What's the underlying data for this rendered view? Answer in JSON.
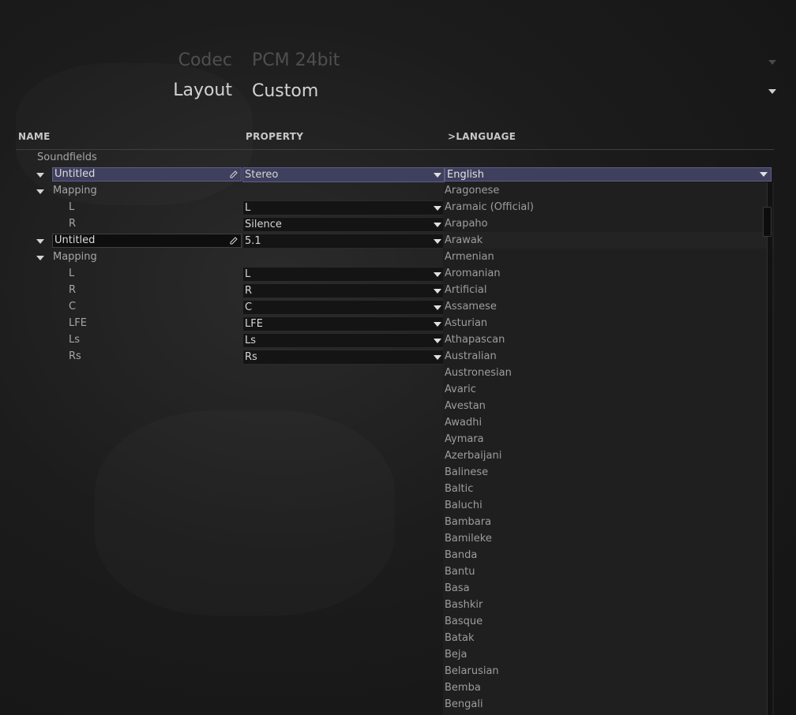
{
  "codec": {
    "label": "Codec",
    "value": "PCM 24bit"
  },
  "layout": {
    "label": "Layout",
    "value": "Custom"
  },
  "columns": {
    "name": "NAME",
    "property": "PROPERTY",
    "language": ">LANGUAGE"
  },
  "tree": {
    "root_label": "Soundfields",
    "soundfield1": {
      "name": "Untitled",
      "property": "Stereo",
      "mapping_label": "Mapping",
      "channels": [
        {
          "name": "L",
          "value": "L"
        },
        {
          "name": "R",
          "value": "Silence"
        }
      ]
    },
    "soundfield2": {
      "name": "Untitled",
      "property": "5.1",
      "mapping_label": "Mapping",
      "channels": [
        {
          "name": "L",
          "value": "L"
        },
        {
          "name": "R",
          "value": "R"
        },
        {
          "name": "C",
          "value": "C"
        },
        {
          "name": "LFE",
          "value": "LFE"
        },
        {
          "name": "Ls",
          "value": "Ls"
        },
        {
          "name": "Rs",
          "value": "Rs"
        }
      ]
    }
  },
  "language": {
    "selected": "English",
    "hovered": "Arawak",
    "options": [
      "Aragonese",
      "Aramaic (Official)",
      "Arapaho",
      "Arawak",
      "Armenian",
      "Aromanian",
      "Artificial",
      "Assamese",
      "Asturian",
      "Athapascan",
      "Australian",
      "Austronesian",
      "Avaric",
      "Avestan",
      "Awadhi",
      "Aymara",
      "Azerbaijani",
      "Balinese",
      "Baltic",
      "Baluchi",
      "Bambara",
      "Bamileke",
      "Banda",
      "Bantu",
      "Basa",
      "Bashkir",
      "Basque",
      "Batak",
      "Beja",
      "Belarusian",
      "Bemba",
      "Bengali"
    ]
  }
}
